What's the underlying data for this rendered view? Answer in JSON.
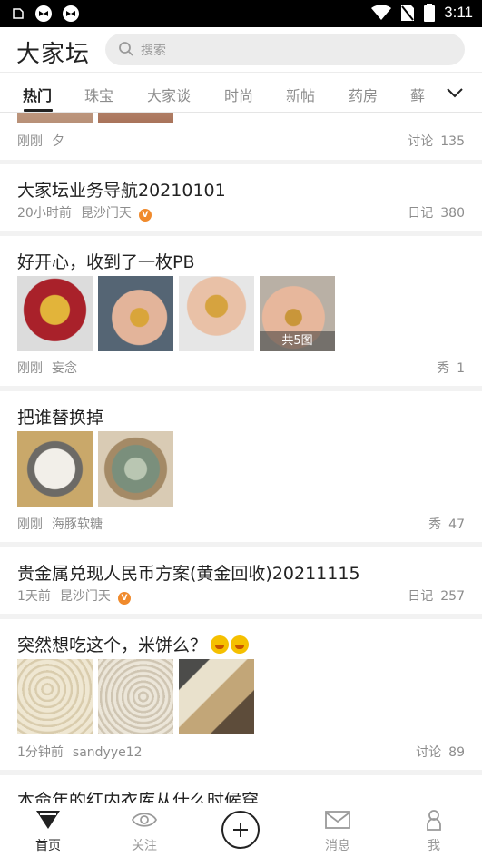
{
  "status_bar": {
    "time": "3:11"
  },
  "header": {
    "logo": "大家坛",
    "search_placeholder": "搜索"
  },
  "tabs": [
    "热门",
    "珠宝",
    "大家谈",
    "时尚",
    "新帖",
    "药房",
    "藓"
  ],
  "feed": [
    {
      "title": "",
      "time": "刚刚",
      "author": "夕",
      "stat_label": "讨论",
      "stat_value": "135"
    },
    {
      "title": "大家坛业务导航20210101",
      "time": "20小时前",
      "author": "昆沙门天",
      "verified": "V",
      "stat_label": "日记",
      "stat_value": "380"
    },
    {
      "title": "好开心，收到了一枚PB",
      "time": "刚刚",
      "author": "妄念",
      "stat_label": "秀",
      "stat_value": "1",
      "image_count_label": "共5图"
    },
    {
      "title": "把谁替换掉",
      "time": "刚刚",
      "author": "海豚软糖",
      "stat_label": "秀",
      "stat_value": "47"
    },
    {
      "title": "贵金属兑现人民币方案(黄金回收)20211115",
      "time": "1天前",
      "author": "昆沙门天",
      "verified": "V",
      "stat_label": "日记",
      "stat_value": "257"
    },
    {
      "title": "突然想吃这个，米饼么？",
      "time": "1分钟前",
      "author": "sandyye12",
      "stat_label": "讨论",
      "stat_value": "89"
    },
    {
      "title": "本命年的红内衣库从什么时候穿"
    }
  ],
  "bottom_nav": {
    "home": "首页",
    "follow": "关注",
    "messages": "消息",
    "me": "我"
  },
  "colors": {
    "accent": "#222222",
    "verified_badge": "#f08a2c",
    "search_bg": "#ececec"
  }
}
